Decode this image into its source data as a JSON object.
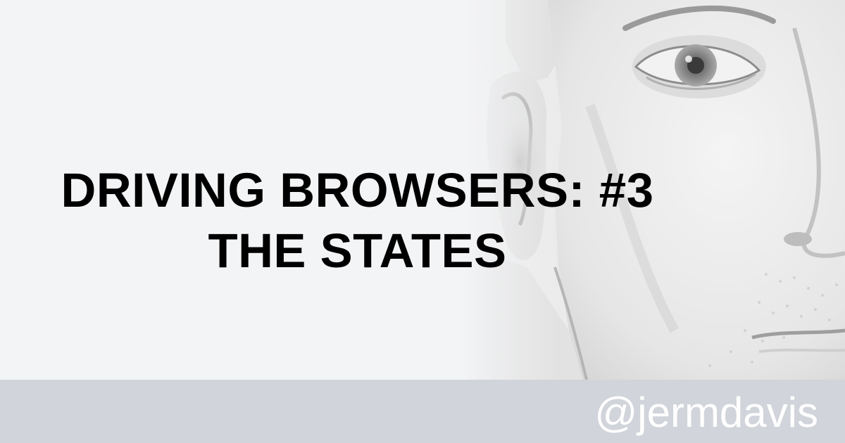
{
  "title": {
    "line1": "DRIVING BROWSERS: #3",
    "line2": "THE STATES"
  },
  "footer": {
    "handle": "@jermdavis"
  },
  "colors": {
    "background": "#f3f4f6",
    "footer_band": "#d1d4da",
    "title_text": "#000000",
    "handle_text": "#ffffff"
  },
  "image": {
    "portrait": "close-up black-and-white face, high-key, eye and ear visible"
  }
}
